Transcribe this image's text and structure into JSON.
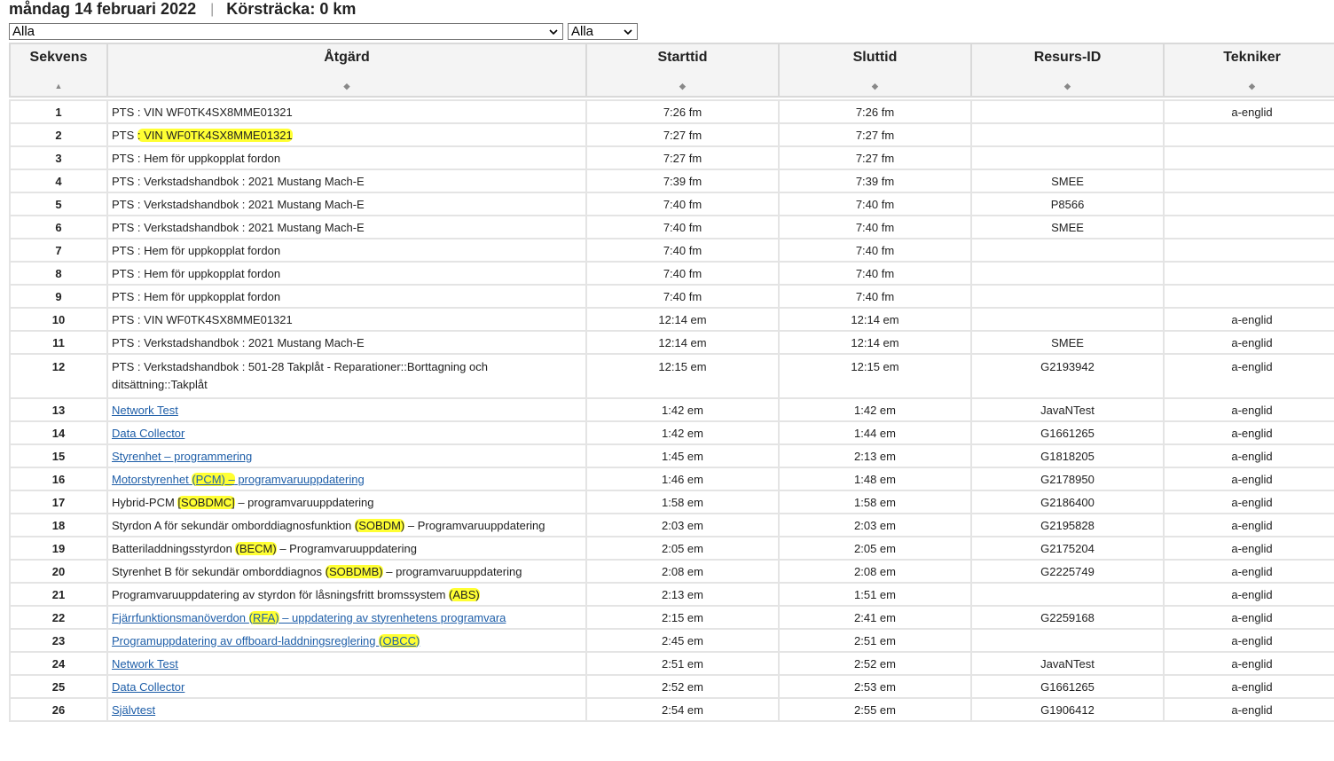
{
  "header": {
    "date": "måndag 14 februari 2022",
    "separator": "|",
    "distance": "Körsträcka: 0 km"
  },
  "filters": {
    "action_filter": "Alla",
    "secondary_filter": "Alla"
  },
  "columns": [
    {
      "label": "Sekvens",
      "sort": "▲"
    },
    {
      "label": "Åtgärd",
      "sort": "◆"
    },
    {
      "label": "Starttid",
      "sort": "◆"
    },
    {
      "label": "Sluttid",
      "sort": "◆"
    },
    {
      "label": "Resurs-ID",
      "sort": "◆"
    },
    {
      "label": "Tekniker",
      "sort": "◆"
    }
  ],
  "highlight_color": "#ffff33",
  "rows": [
    {
      "seq": "1",
      "action": [
        {
          "t": "PTS : VIN WF0TK4SX8MME01321"
        }
      ],
      "start": "7:26 fm",
      "end": "7:26 fm",
      "resource": "",
      "tech": "a-englid"
    },
    {
      "seq": "2",
      "action": [
        {
          "t": "PTS "
        },
        {
          "t": ": VIN WF0TK4SX8MME01321",
          "hl": true
        }
      ],
      "start": "7:27 fm",
      "end": "7:27 fm",
      "resource": "",
      "tech": ""
    },
    {
      "seq": "3",
      "action": [
        {
          "t": "PTS : Hem för uppkopplat fordon"
        }
      ],
      "start": "7:27 fm",
      "end": "7:27 fm",
      "resource": "",
      "tech": ""
    },
    {
      "seq": "4",
      "action": [
        {
          "t": "PTS : Verkstadshandbok : 2021 Mustang Mach-E"
        }
      ],
      "start": "7:39 fm",
      "end": "7:39 fm",
      "resource": "SMEE",
      "tech": ""
    },
    {
      "seq": "5",
      "action": [
        {
          "t": "PTS : Verkstadshandbok : 2021 Mustang Mach-E"
        }
      ],
      "start": "7:40 fm",
      "end": "7:40 fm",
      "resource": "P8566",
      "tech": ""
    },
    {
      "seq": "6",
      "action": [
        {
          "t": "PTS : Verkstadshandbok : 2021 Mustang Mach-E"
        }
      ],
      "start": "7:40 fm",
      "end": "7:40 fm",
      "resource": "SMEE",
      "tech": ""
    },
    {
      "seq": "7",
      "action": [
        {
          "t": "PTS : Hem för uppkopplat fordon"
        }
      ],
      "start": "7:40 fm",
      "end": "7:40 fm",
      "resource": "",
      "tech": ""
    },
    {
      "seq": "8",
      "action": [
        {
          "t": "PTS : Hem för uppkopplat fordon"
        }
      ],
      "start": "7:40 fm",
      "end": "7:40 fm",
      "resource": "",
      "tech": ""
    },
    {
      "seq": "9",
      "action": [
        {
          "t": "PTS : Hem för uppkopplat fordon"
        }
      ],
      "start": "7:40 fm",
      "end": "7:40 fm",
      "resource": "",
      "tech": ""
    },
    {
      "seq": "10",
      "action": [
        {
          "t": "PTS : VIN WF0TK4SX8MME01321"
        }
      ],
      "start": "12:14 em",
      "end": "12:14 em",
      "resource": "",
      "tech": "a-englid"
    },
    {
      "seq": "11",
      "action": [
        {
          "t": "PTS : Verkstadshandbok : 2021 Mustang Mach-E"
        }
      ],
      "start": "12:14 em",
      "end": "12:14 em",
      "resource": "SMEE",
      "tech": "a-englid"
    },
    {
      "seq": "12",
      "tall": true,
      "action": [
        {
          "t": "PTS : Verkstadshandbok : 501-28 Takplåt - Reparationer::Borttagning och ditsättning::Takplåt"
        }
      ],
      "start": "12:15 em",
      "end": "12:15 em",
      "resource": "G2193942",
      "tech": "a-englid"
    },
    {
      "seq": "13",
      "action": [
        {
          "t": "Network Test",
          "link": true
        }
      ],
      "start": "1:42 em",
      "end": "1:42 em",
      "resource": "JavaNTest",
      "tech": "a-englid"
    },
    {
      "seq": "14",
      "action": [
        {
          "t": "Data Collector",
          "link": true
        }
      ],
      "start": "1:42 em",
      "end": "1:44 em",
      "resource": "G1661265",
      "tech": "a-englid"
    },
    {
      "seq": "15",
      "action": [
        {
          "t": "Styrenhet – programmering",
          "link": true
        }
      ],
      "start": "1:45 em",
      "end": "2:13 em",
      "resource": "G1818205",
      "tech": "a-englid"
    },
    {
      "seq": "16",
      "action": [
        {
          "t": "Motorstyrenhet ",
          "link": true
        },
        {
          "t": "(PCM) –",
          "link": true,
          "hl": true
        },
        {
          "t": " programvaruuppdatering",
          "link": true
        }
      ],
      "start": "1:46 em",
      "end": "1:48 em",
      "resource": "G2178950",
      "tech": "a-englid"
    },
    {
      "seq": "17",
      "action": [
        {
          "t": "Hybrid-PCM "
        },
        {
          "t": "[SOBDMC]",
          "hl": true
        },
        {
          "t": " – programvaruuppdatering"
        }
      ],
      "start": "1:58 em",
      "end": "1:58 em",
      "resource": "G2186400",
      "tech": "a-englid"
    },
    {
      "seq": "18",
      "action": [
        {
          "t": "Styrdon A för sekundär omborddiagnosfunktion "
        },
        {
          "t": "(SOBDM)",
          "hl": true
        },
        {
          "t": " – Programvaruuppdatering"
        }
      ],
      "start": "2:03 em",
      "end": "2:03 em",
      "resource": "G2195828",
      "tech": "a-englid"
    },
    {
      "seq": "19",
      "action": [
        {
          "t": "Batteriladdningsstyrdon "
        },
        {
          "t": "(BECM)",
          "hl": true
        },
        {
          "t": " – Programvaruuppdatering"
        }
      ],
      "start": "2:05 em",
      "end": "2:05 em",
      "resource": "G2175204",
      "tech": "a-englid"
    },
    {
      "seq": "20",
      "action": [
        {
          "t": "Styrenhet B för sekundär omborddiagnos "
        },
        {
          "t": "(SOBDMB)",
          "hl": true
        },
        {
          "t": " – programvaruuppdatering"
        }
      ],
      "start": "2:08 em",
      "end": "2:08 em",
      "resource": "G2225749",
      "tech": "a-englid"
    },
    {
      "seq": "21",
      "action": [
        {
          "t": "Programvaruuppdatering av styrdon för låsningsfritt bromssystem "
        },
        {
          "t": "(ABS)",
          "hl": true
        }
      ],
      "start": "2:13 em",
      "end": "1:51 em",
      "resource": "",
      "tech": "a-englid"
    },
    {
      "seq": "22",
      "action": [
        {
          "t": "Fjärrfunktionsmanöverdon ",
          "link": true
        },
        {
          "t": "(RFA)",
          "link": true,
          "hl": true
        },
        {
          "t": " – uppdatering av styrenhetens programvara",
          "link": true
        }
      ],
      "start": "2:15 em",
      "end": "2:41 em",
      "resource": "G2259168",
      "tech": "a-englid"
    },
    {
      "seq": "23",
      "action": [
        {
          "t": "Programuppdatering av offboard-laddningsreglering ",
          "link": true
        },
        {
          "t": "(OBCC)",
          "link": true,
          "hl": true
        }
      ],
      "start": "2:45 em",
      "end": "2:51 em",
      "resource": "",
      "tech": "a-englid"
    },
    {
      "seq": "24",
      "action": [
        {
          "t": "Network Test",
          "link": true
        }
      ],
      "start": "2:51 em",
      "end": "2:52 em",
      "resource": "JavaNTest",
      "tech": "a-englid"
    },
    {
      "seq": "25",
      "action": [
        {
          "t": "Data Collector",
          "link": true
        }
      ],
      "start": "2:52 em",
      "end": "2:53 em",
      "resource": "G1661265",
      "tech": "a-englid"
    },
    {
      "seq": "26",
      "action": [
        {
          "t": "Självtest",
          "link": true
        }
      ],
      "start": "2:54 em",
      "end": "2:55 em",
      "resource": "G1906412",
      "tech": "a-englid"
    }
  ]
}
